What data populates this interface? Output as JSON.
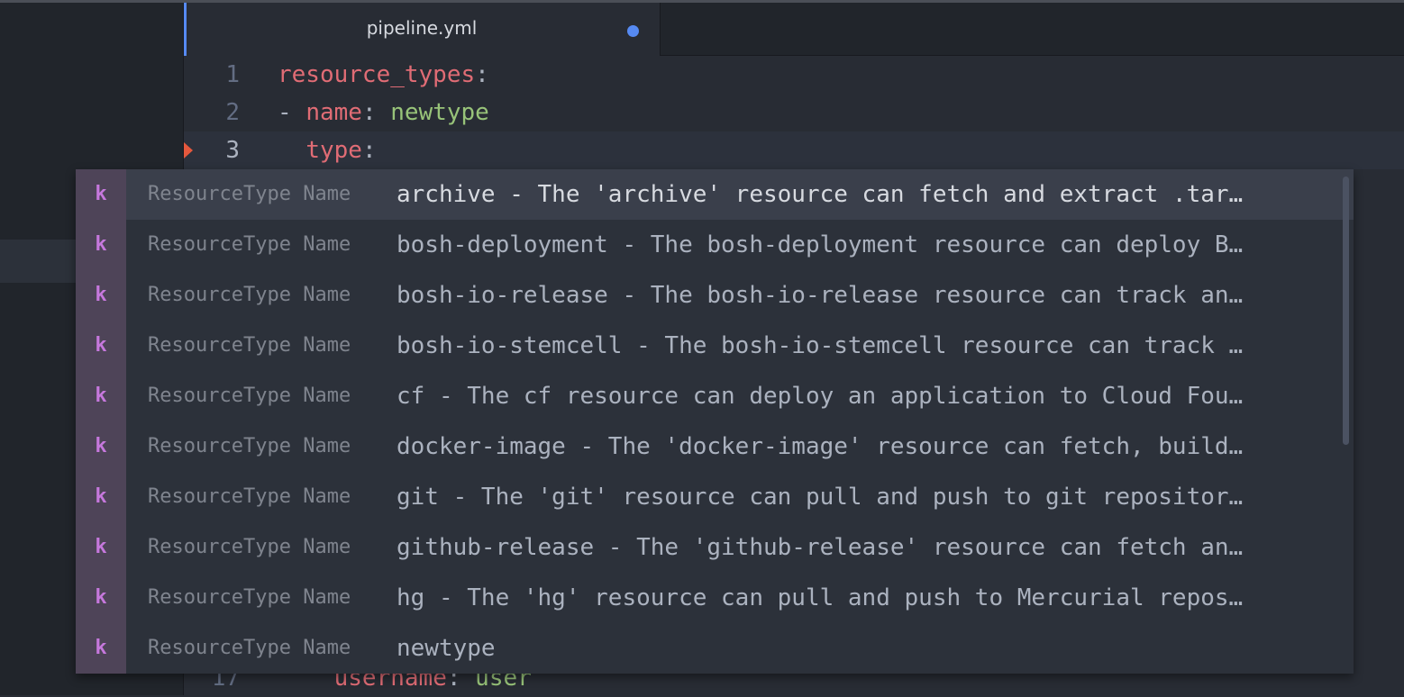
{
  "tab": {
    "title": "pipeline.yml"
  },
  "lines": [
    {
      "num": "1",
      "key": "resource_types",
      "colon": ":"
    },
    {
      "num": "2",
      "dash": "- ",
      "key": "name",
      "colon": ": ",
      "value": "newtype"
    },
    {
      "num": "3",
      "indent": "  ",
      "key": "type",
      "colon": ":"
    },
    {
      "num": "17",
      "indent": "    ",
      "key": "username",
      "colon": ": ",
      "value": "user"
    }
  ],
  "autocomplete": {
    "badge": "k",
    "type_label": "ResourceType",
    "kind_label": "Name",
    "items": [
      "archive - The 'archive' resource can fetch and extract .tar…",
      "bosh-deployment - The bosh-deployment resource can deploy B…",
      "bosh-io-release - The bosh-io-release resource can track an…",
      "bosh-io-stemcell - The bosh-io-stemcell resource can track …",
      "cf - The cf resource can deploy an application to Cloud Fou…",
      "docker-image - The 'docker-image' resource can fetch, build…",
      "git - The 'git' resource can pull and push to git repositor…",
      "github-release - The 'github-release' resource can fetch an…",
      "hg - The 'hg' resource can pull and push to Mercurial repos…",
      "newtype"
    ]
  }
}
